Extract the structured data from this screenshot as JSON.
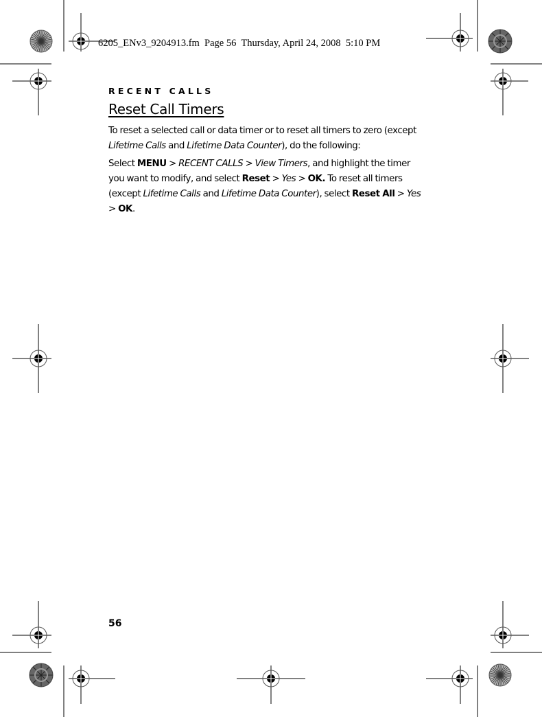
{
  "slug": "6205_ENv3_9204913.fm  Page 56  Thursday, April 24, 2008  5:10 PM",
  "section_header": "RECENT CALLS",
  "title": "Reset Call Timers",
  "paragraph1": {
    "t1": "To reset a selected call or data timer or to reset all timers to zero (except ",
    "i1": "Lifetime Calls",
    "t2": " and ",
    "i2": "Lifetime Data Counter",
    "t3": "), do the following:"
  },
  "paragraph2": {
    "t1": "Select ",
    "b1": "MENU",
    "t2": " > ",
    "i1": "RECENT CALLS",
    "t3": " > ",
    "i2": "View Timers",
    "t4": ", and highlight the timer you want to modify, and select ",
    "b2": "Reset",
    "t5": " > ",
    "i3": "Yes",
    "t6": " > ",
    "b3": "OK.",
    "t7": " To reset all timers (except ",
    "i4": "Lifetime Calls",
    "t8": " and ",
    "i5": "Lifetime Data Counter",
    "t9": "), select ",
    "b4": "Reset All",
    "t10": " > ",
    "i6": "Yes",
    "t11": " > ",
    "b5": "OK",
    "t12": "."
  },
  "page_number": "56",
  "icons": {
    "registration_mark": "crosshair-registration-icon",
    "color_wheel": "starburst-target-icon"
  }
}
